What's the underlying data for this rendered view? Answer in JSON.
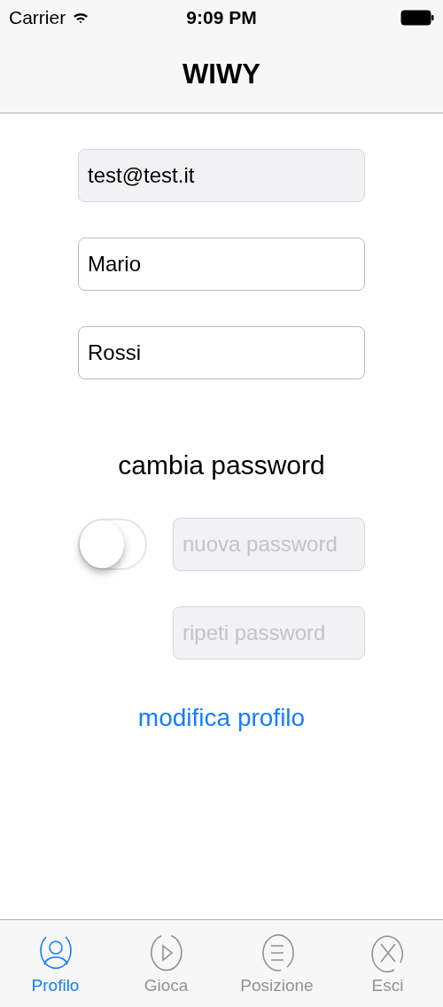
{
  "status_bar": {
    "carrier": "Carrier",
    "time": "9:09 PM"
  },
  "nav_bar": {
    "title": "WIWY"
  },
  "fields": [
    {
      "value": "test@test.it",
      "disabled": true
    },
    {
      "value": "Mario",
      "disabled": false
    },
    {
      "value": "Rossi",
      "disabled": false
    }
  ],
  "password_section": {
    "label": "cambia password",
    "toggle": {
      "on": false
    },
    "fields": [
      {
        "placeholder": "nuova password",
        "disabled": true
      },
      {
        "placeholder": "ripeti password",
        "disabled": true
      }
    ]
  },
  "action": {
    "label": "modifica profilo"
  },
  "tab_bar": [
    {
      "kind": "person",
      "label": "Profilo",
      "selected": true
    },
    {
      "kind": "play",
      "label": "Gioca",
      "selected": false
    },
    {
      "kind": "list",
      "label": "Posizione",
      "selected": false
    },
    {
      "kind": "close",
      "label": "Esci",
      "selected": false
    }
  ]
}
